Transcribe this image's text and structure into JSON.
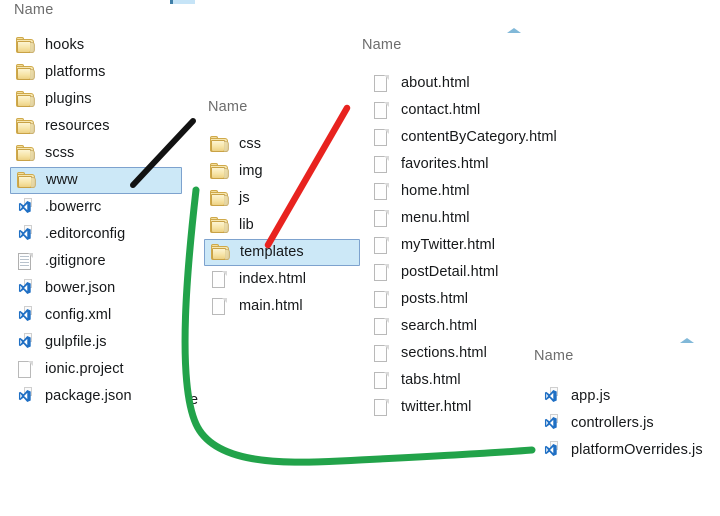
{
  "columns": [
    {
      "id": "project-root",
      "header": "Name",
      "items": [
        {
          "label": "hooks",
          "icon": "folder-icon",
          "selected": false
        },
        {
          "label": "platforms",
          "icon": "folder-icon",
          "selected": false
        },
        {
          "label": "plugins",
          "icon": "folder-icon",
          "selected": false
        },
        {
          "label": "resources",
          "icon": "folder-icon",
          "selected": false
        },
        {
          "label": "scss",
          "icon": "folder-icon",
          "selected": false
        },
        {
          "label": "www",
          "icon": "folder-icon",
          "selected": true
        },
        {
          "label": ".bowerrc",
          "icon": "vs-file-icon",
          "selected": false
        },
        {
          "label": ".editorconfig",
          "icon": "vs-file-icon",
          "selected": false
        },
        {
          "label": ".gitignore",
          "icon": "text-file-icon",
          "selected": false
        },
        {
          "label": "bower.json",
          "icon": "vs-file-icon",
          "selected": false
        },
        {
          "label": "config.xml",
          "icon": "vs-file-icon",
          "selected": false
        },
        {
          "label": "gulpfile.js",
          "icon": "vs-file-icon",
          "selected": false
        },
        {
          "label": "ionic.project",
          "icon": "blank-file-icon",
          "selected": false
        },
        {
          "label": "package.json",
          "icon": "vs-file-icon",
          "selected": false
        }
      ]
    },
    {
      "id": "www-folder",
      "header": "Name",
      "items": [
        {
          "label": "css",
          "icon": "folder-icon",
          "selected": false
        },
        {
          "label": "img",
          "icon": "folder-icon",
          "selected": false
        },
        {
          "label": "js",
          "icon": "folder-icon",
          "selected": false
        },
        {
          "label": "lib",
          "icon": "folder-icon",
          "selected": false
        },
        {
          "label": "templates",
          "icon": "folder-icon",
          "selected": true
        },
        {
          "label": "index.html",
          "icon": "blank-file-icon",
          "selected": false
        },
        {
          "label": "main.html",
          "icon": "blank-file-icon",
          "selected": false
        }
      ]
    },
    {
      "id": "templates-folder",
      "header": "Name",
      "items": [
        {
          "label": "about.html",
          "icon": "blank-file-icon",
          "selected": false
        },
        {
          "label": "contact.html",
          "icon": "blank-file-icon",
          "selected": false
        },
        {
          "label": "contentByCategory.html",
          "icon": "blank-file-icon",
          "selected": false
        },
        {
          "label": "favorites.html",
          "icon": "blank-file-icon",
          "selected": false
        },
        {
          "label": "home.html",
          "icon": "blank-file-icon",
          "selected": false
        },
        {
          "label": "menu.html",
          "icon": "blank-file-icon",
          "selected": false
        },
        {
          "label": "myTwitter.html",
          "icon": "blank-file-icon",
          "selected": false
        },
        {
          "label": "postDetail.html",
          "icon": "blank-file-icon",
          "selected": false
        },
        {
          "label": "posts.html",
          "icon": "blank-file-icon",
          "selected": false
        },
        {
          "label": "search.html",
          "icon": "blank-file-icon",
          "selected": false
        },
        {
          "label": "sections.html",
          "icon": "blank-file-icon",
          "selected": false
        },
        {
          "label": "tabs.html",
          "icon": "blank-file-icon",
          "selected": false
        },
        {
          "label": "twitter.html",
          "icon": "blank-file-icon",
          "selected": false
        }
      ]
    },
    {
      "id": "js-folder",
      "header": "Name",
      "items": [
        {
          "label": "app.js",
          "icon": "vs-file-icon",
          "selected": false
        },
        {
          "label": "controllers.js",
          "icon": "vs-file-icon",
          "selected": false
        },
        {
          "label": "platformOverrides.js",
          "icon": "vs-file-icon",
          "selected": false
        }
      ]
    }
  ],
  "fragments": {
    "clipped_text": "te"
  },
  "annotations": [
    {
      "id": "black-arrow",
      "color": "#111111",
      "describes": "points from www folder selection"
    },
    {
      "id": "red-arrow",
      "color": "#e8231f",
      "describes": "points to templates folder"
    },
    {
      "id": "green-curve",
      "color": "#22a34a",
      "describes": "curve from js folder to platformOverrides.js"
    }
  ],
  "colors": {
    "selection_fill": "#cce8f7",
    "selection_border": "#7da2ce",
    "header_text": "#6d6d6d",
    "caret": "#7ab4d6",
    "folder": "#f0d98c",
    "vs_icon": "#1f6fc4"
  }
}
